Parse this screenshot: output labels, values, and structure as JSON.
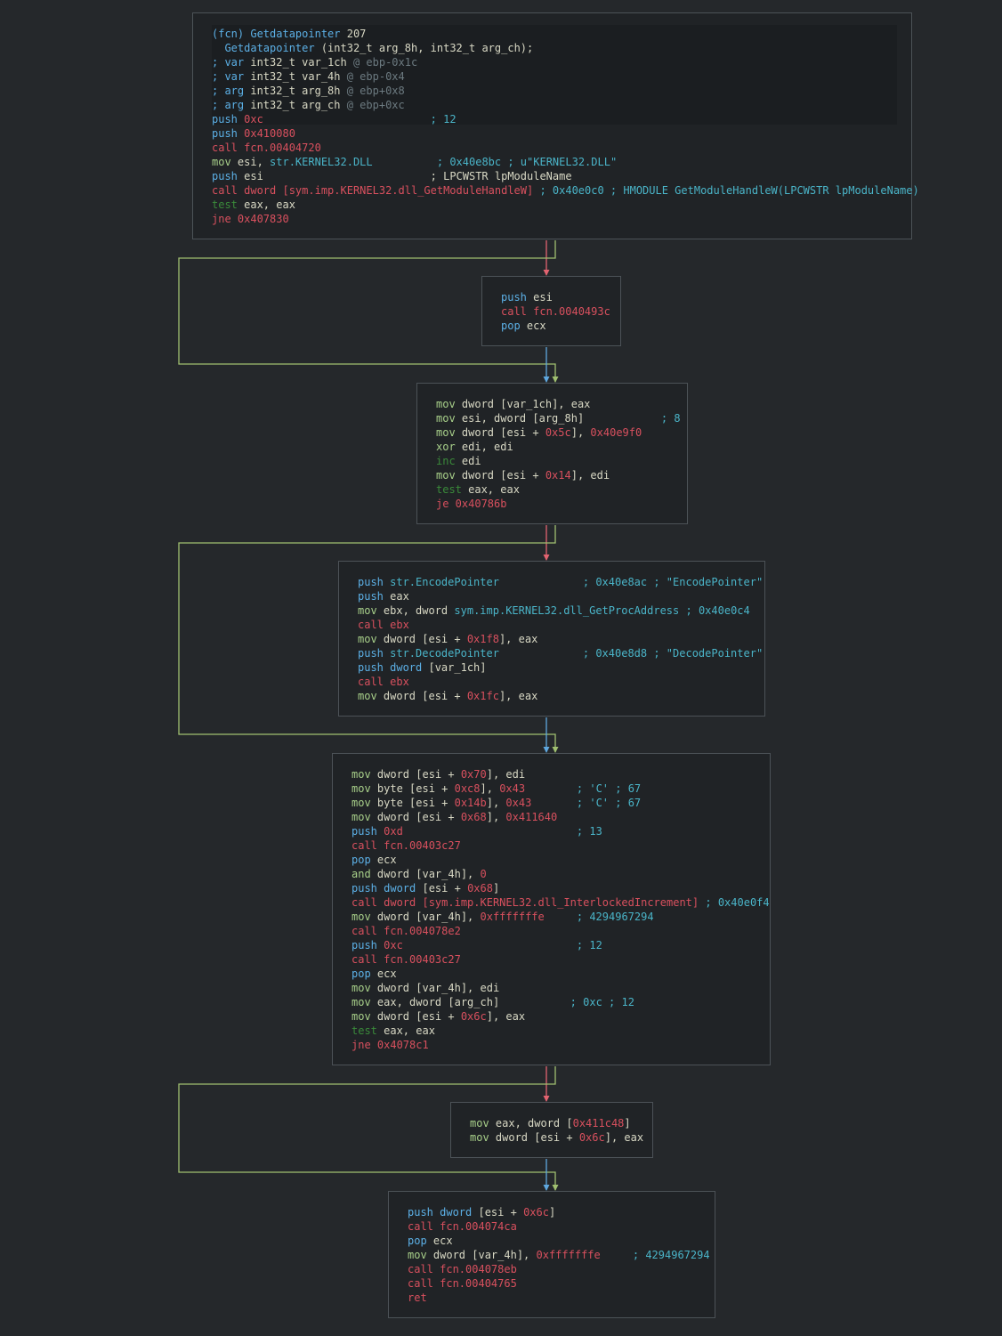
{
  "colors": {
    "background": "#25282b",
    "block_bg": "#202326",
    "block_border": "#4c5257",
    "edge_true": "#a0c070",
    "edge_false": "#e26370",
    "edge_uncond": "#5fa8e0"
  },
  "blocks": [
    {
      "id": "b0",
      "highlight_lines": 7,
      "lines": [
        [
          {
            "t": "(fcn) Getdatapointer ",
            "c": "k"
          },
          {
            "t": "207",
            "c": "o"
          }
        ],
        [
          {
            "t": "  Getdatapointer ",
            "c": "k"
          },
          {
            "t": "(int32_t arg_8h, int32_t arg_ch);",
            "c": "o"
          }
        ],
        [
          {
            "t": "; var ",
            "c": "k"
          },
          {
            "t": "int32_t var_1ch ",
            "c": "o"
          },
          {
            "t": "@ ebp-0x1c",
            "c": "g"
          }
        ],
        [
          {
            "t": "; var ",
            "c": "k"
          },
          {
            "t": "int32_t var_4h ",
            "c": "o"
          },
          {
            "t": "@ ebp-0x4",
            "c": "g"
          }
        ],
        [
          {
            "t": "; arg ",
            "c": "k"
          },
          {
            "t": "int32_t arg_8h ",
            "c": "o"
          },
          {
            "t": "@ ebp+0x8",
            "c": "g"
          }
        ],
        [
          {
            "t": "; arg ",
            "c": "k"
          },
          {
            "t": "int32_t arg_ch ",
            "c": "o"
          },
          {
            "t": "@ ebp+0xc",
            "c": "g"
          }
        ],
        [
          {
            "t": "push ",
            "c": "k"
          },
          {
            "t": "0xc",
            "c": "n"
          },
          {
            "t": "                          ",
            "c": "o"
          },
          {
            "t": "; 12",
            "c": "c"
          }
        ],
        [
          {
            "t": "push ",
            "c": "k"
          },
          {
            "t": "0x410080",
            "c": "n"
          }
        ],
        [
          {
            "t": "call fcn.00404720",
            "c": "f"
          }
        ],
        [
          {
            "t": "mov ",
            "c": "m"
          },
          {
            "t": "esi, ",
            "c": "o"
          },
          {
            "t": "str.KERNEL32.DLL",
            "c": "s"
          },
          {
            "t": "          ",
            "c": "o"
          },
          {
            "t": "; 0x40e8bc ; u\"KERNEL32.DLL\"",
            "c": "c"
          }
        ],
        [
          {
            "t": "push ",
            "c": "k"
          },
          {
            "t": "esi                          ; LPCWSTR lpModuleName",
            "c": "o"
          }
        ],
        [
          {
            "t": "call dword [sym.imp.KERNEL32.dll_GetModuleHandleW]",
            "c": "f"
          },
          {
            "t": " ; 0x40e0c0 ; HMODULE GetModuleHandleW(LPCWSTR lpModuleName)",
            "c": "c"
          }
        ],
        [
          {
            "t": "test ",
            "c": "t"
          },
          {
            "t": "eax, eax",
            "c": "o"
          }
        ],
        [
          {
            "t": "jne 0x407830",
            "c": "j"
          }
        ]
      ]
    },
    {
      "id": "b1",
      "lines": [
        [
          {
            "t": "push ",
            "c": "k"
          },
          {
            "t": "esi",
            "c": "o"
          }
        ],
        [
          {
            "t": "call fcn.0040493c",
            "c": "f"
          }
        ],
        [
          {
            "t": "pop ",
            "c": "k"
          },
          {
            "t": "ecx",
            "c": "o"
          }
        ]
      ]
    },
    {
      "id": "b2",
      "lines": [
        [
          {
            "t": "mov ",
            "c": "m"
          },
          {
            "t": "dword ",
            "c": "o"
          },
          {
            "t": "[var_1ch], eax",
            "c": "o"
          }
        ],
        [
          {
            "t": "mov ",
            "c": "m"
          },
          {
            "t": "esi, dword [arg_8h]",
            "c": "o"
          },
          {
            "t": "            ",
            "c": "o"
          },
          {
            "t": "; 8",
            "c": "c"
          }
        ],
        [
          {
            "t": "mov ",
            "c": "m"
          },
          {
            "t": "dword [esi + ",
            "c": "o"
          },
          {
            "t": "0x5c",
            "c": "n"
          },
          {
            "t": "], ",
            "c": "o"
          },
          {
            "t": "0x40e9f0",
            "c": "n"
          }
        ],
        [
          {
            "t": "xor ",
            "c": "m"
          },
          {
            "t": "edi, edi",
            "c": "o"
          }
        ],
        [
          {
            "t": "inc ",
            "c": "t"
          },
          {
            "t": "edi",
            "c": "o"
          }
        ],
        [
          {
            "t": "mov ",
            "c": "m"
          },
          {
            "t": "dword [esi + ",
            "c": "o"
          },
          {
            "t": "0x14",
            "c": "n"
          },
          {
            "t": "], edi",
            "c": "o"
          }
        ],
        [
          {
            "t": "test ",
            "c": "t"
          },
          {
            "t": "eax, eax",
            "c": "o"
          }
        ],
        [
          {
            "t": "je 0x40786b",
            "c": "j"
          }
        ]
      ]
    },
    {
      "id": "b3",
      "lines": [
        [
          {
            "t": "push ",
            "c": "k"
          },
          {
            "t": "str.EncodePointer",
            "c": "s"
          },
          {
            "t": "             ",
            "c": "o"
          },
          {
            "t": "; 0x40e8ac ; \"EncodePointer\"",
            "c": "c"
          }
        ],
        [
          {
            "t": "push ",
            "c": "k"
          },
          {
            "t": "eax",
            "c": "o"
          }
        ],
        [
          {
            "t": "mov ",
            "c": "m"
          },
          {
            "t": "ebx, dword ",
            "c": "o"
          },
          {
            "t": "sym.imp.KERNEL32.dll_GetProcAddress",
            "c": "s"
          },
          {
            "t": " ; 0x40e0c4",
            "c": "c"
          }
        ],
        [
          {
            "t": "call ebx",
            "c": "f"
          }
        ],
        [
          {
            "t": "mov ",
            "c": "m"
          },
          {
            "t": "dword [esi + ",
            "c": "o"
          },
          {
            "t": "0x1f8",
            "c": "n"
          },
          {
            "t": "], eax",
            "c": "o"
          }
        ],
        [
          {
            "t": "push ",
            "c": "k"
          },
          {
            "t": "str.DecodePointer",
            "c": "s"
          },
          {
            "t": "             ",
            "c": "o"
          },
          {
            "t": "; 0x40e8d8 ; \"DecodePointer\"",
            "c": "c"
          }
        ],
        [
          {
            "t": "push dword ",
            "c": "k"
          },
          {
            "t": "[var_1ch]",
            "c": "o"
          }
        ],
        [
          {
            "t": "call ebx",
            "c": "f"
          }
        ],
        [
          {
            "t": "mov ",
            "c": "m"
          },
          {
            "t": "dword [esi + ",
            "c": "o"
          },
          {
            "t": "0x1fc",
            "c": "n"
          },
          {
            "t": "], eax",
            "c": "o"
          }
        ]
      ]
    },
    {
      "id": "b4",
      "lines": [
        [
          {
            "t": "mov ",
            "c": "m"
          },
          {
            "t": "dword [esi + ",
            "c": "o"
          },
          {
            "t": "0x70",
            "c": "n"
          },
          {
            "t": "], edi",
            "c": "o"
          }
        ],
        [
          {
            "t": "mov ",
            "c": "m"
          },
          {
            "t": "byte [esi + ",
            "c": "o"
          },
          {
            "t": "0xc8",
            "c": "n"
          },
          {
            "t": "], ",
            "c": "o"
          },
          {
            "t": "0x43",
            "c": "n"
          },
          {
            "t": "        ",
            "c": "o"
          },
          {
            "t": "; 'C' ; 67",
            "c": "c"
          }
        ],
        [
          {
            "t": "mov ",
            "c": "m"
          },
          {
            "t": "byte [esi + ",
            "c": "o"
          },
          {
            "t": "0x14b",
            "c": "n"
          },
          {
            "t": "], ",
            "c": "o"
          },
          {
            "t": "0x43",
            "c": "n"
          },
          {
            "t": "       ",
            "c": "o"
          },
          {
            "t": "; 'C' ; 67",
            "c": "c"
          }
        ],
        [
          {
            "t": "mov ",
            "c": "m"
          },
          {
            "t": "dword [esi + ",
            "c": "o"
          },
          {
            "t": "0x68",
            "c": "n"
          },
          {
            "t": "], ",
            "c": "o"
          },
          {
            "t": "0x411640",
            "c": "n"
          }
        ],
        [
          {
            "t": "push ",
            "c": "k"
          },
          {
            "t": "0xd",
            "c": "n"
          },
          {
            "t": "                           ",
            "c": "o"
          },
          {
            "t": "; 13",
            "c": "c"
          }
        ],
        [
          {
            "t": "call fcn.00403c27",
            "c": "f"
          }
        ],
        [
          {
            "t": "pop ",
            "c": "k"
          },
          {
            "t": "ecx",
            "c": "o"
          }
        ],
        [
          {
            "t": "and ",
            "c": "m"
          },
          {
            "t": "dword [var_4h], ",
            "c": "o"
          },
          {
            "t": "0",
            "c": "n"
          }
        ],
        [
          {
            "t": "push dword ",
            "c": "k"
          },
          {
            "t": "[esi + ",
            "c": "o"
          },
          {
            "t": "0x68",
            "c": "n"
          },
          {
            "t": "]",
            "c": "o"
          }
        ],
        [
          {
            "t": "call dword [sym.imp.KERNEL32.dll_InterlockedIncrement]",
            "c": "f"
          },
          {
            "t": " ; 0x40e0f4",
            "c": "c"
          }
        ],
        [
          {
            "t": "mov ",
            "c": "m"
          },
          {
            "t": "dword [var_4h], ",
            "c": "o"
          },
          {
            "t": "0xfffffffe",
            "c": "n"
          },
          {
            "t": "     ",
            "c": "o"
          },
          {
            "t": "; 4294967294",
            "c": "c"
          }
        ],
        [
          {
            "t": "call fcn.004078e2",
            "c": "f"
          }
        ],
        [
          {
            "t": "push ",
            "c": "k"
          },
          {
            "t": "0xc",
            "c": "n"
          },
          {
            "t": "                           ",
            "c": "o"
          },
          {
            "t": "; 12",
            "c": "c"
          }
        ],
        [
          {
            "t": "call fcn.00403c27",
            "c": "f"
          }
        ],
        [
          {
            "t": "pop ",
            "c": "k"
          },
          {
            "t": "ecx",
            "c": "o"
          }
        ],
        [
          {
            "t": "mov ",
            "c": "m"
          },
          {
            "t": "dword [var_4h], edi",
            "c": "o"
          }
        ],
        [
          {
            "t": "mov ",
            "c": "m"
          },
          {
            "t": "eax, dword [arg_ch]",
            "c": "o"
          },
          {
            "t": "           ",
            "c": "o"
          },
          {
            "t": "; 0xc ; 12",
            "c": "c"
          }
        ],
        [
          {
            "t": "mov ",
            "c": "m"
          },
          {
            "t": "dword [esi + ",
            "c": "o"
          },
          {
            "t": "0x6c",
            "c": "n"
          },
          {
            "t": "], eax",
            "c": "o"
          }
        ],
        [
          {
            "t": "test ",
            "c": "t"
          },
          {
            "t": "eax, eax",
            "c": "o"
          }
        ],
        [
          {
            "t": "jne 0x4078c1",
            "c": "j"
          }
        ]
      ]
    },
    {
      "id": "b5",
      "lines": [
        [
          {
            "t": "mov ",
            "c": "m"
          },
          {
            "t": "eax, dword [",
            "c": "o"
          },
          {
            "t": "0x411c48",
            "c": "n"
          },
          {
            "t": "]",
            "c": "o"
          }
        ],
        [
          {
            "t": "mov ",
            "c": "m"
          },
          {
            "t": "dword [esi + ",
            "c": "o"
          },
          {
            "t": "0x6c",
            "c": "n"
          },
          {
            "t": "], eax",
            "c": "o"
          }
        ]
      ]
    },
    {
      "id": "b6",
      "lines": [
        [
          {
            "t": "push dword ",
            "c": "k"
          },
          {
            "t": "[esi + ",
            "c": "o"
          },
          {
            "t": "0x6c",
            "c": "n"
          },
          {
            "t": "]",
            "c": "o"
          }
        ],
        [
          {
            "t": "call fcn.004074ca",
            "c": "f"
          }
        ],
        [
          {
            "t": "pop ",
            "c": "k"
          },
          {
            "t": "ecx",
            "c": "o"
          }
        ],
        [
          {
            "t": "mov ",
            "c": "m"
          },
          {
            "t": "dword [var_4h], ",
            "c": "o"
          },
          {
            "t": "0xfffffffe",
            "c": "n"
          },
          {
            "t": "     ",
            "c": "o"
          },
          {
            "t": "; 4294967294",
            "c": "c"
          }
        ],
        [
          {
            "t": "call fcn.004078eb",
            "c": "f"
          }
        ],
        [
          {
            "t": "call fcn.00404765",
            "c": "f"
          }
        ],
        [
          {
            "t": "ret",
            "c": "r"
          }
        ]
      ]
    }
  ]
}
